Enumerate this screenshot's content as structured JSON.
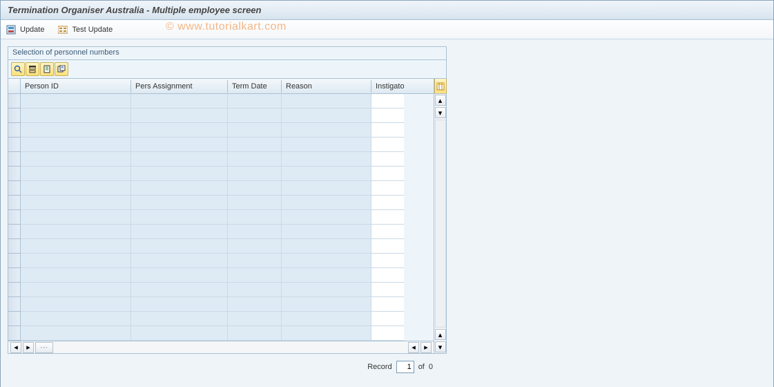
{
  "window": {
    "title": "Termination Organiser Australia - Multiple employee screen"
  },
  "toolbar": {
    "update_label": "Update",
    "test_update_label": "Test Update"
  },
  "groupbox": {
    "title": "Selection of personnel numbers"
  },
  "grid": {
    "columns": {
      "person_id": "Person ID",
      "pers_assignment": "Pers Assignment",
      "term_date": "Term Date",
      "reason": "Reason",
      "instigator": "Instigato"
    },
    "row_count": 17
  },
  "footer": {
    "record_label": "Record",
    "record_value": "1",
    "of_label": "of",
    "total": "0"
  },
  "watermark": "© www.tutorialkart.com"
}
